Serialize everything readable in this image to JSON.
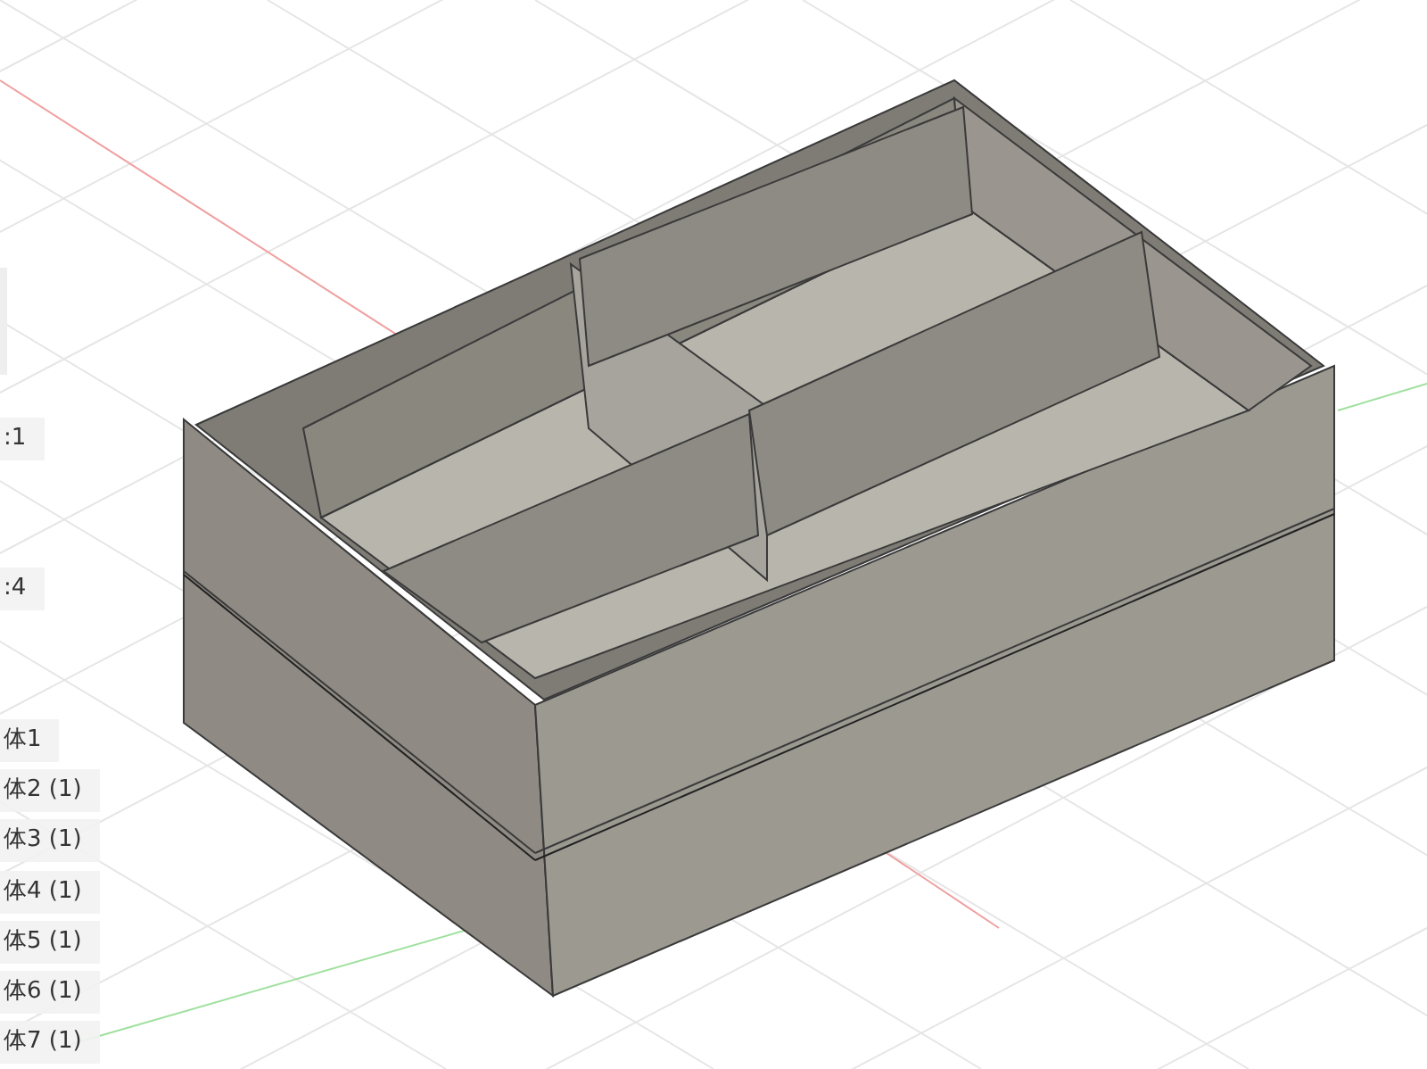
{
  "browser_labels": [
    {
      "text": ":1"
    },
    {
      "text": ":4"
    },
    {
      "text": "体1"
    },
    {
      "text": "体2 (1)"
    },
    {
      "text": "体3 (1)"
    },
    {
      "text": "体4 (1)"
    },
    {
      "text": "体5 (1)"
    },
    {
      "text": "体6 (1)"
    },
    {
      "text": "体7 (1)"
    }
  ]
}
